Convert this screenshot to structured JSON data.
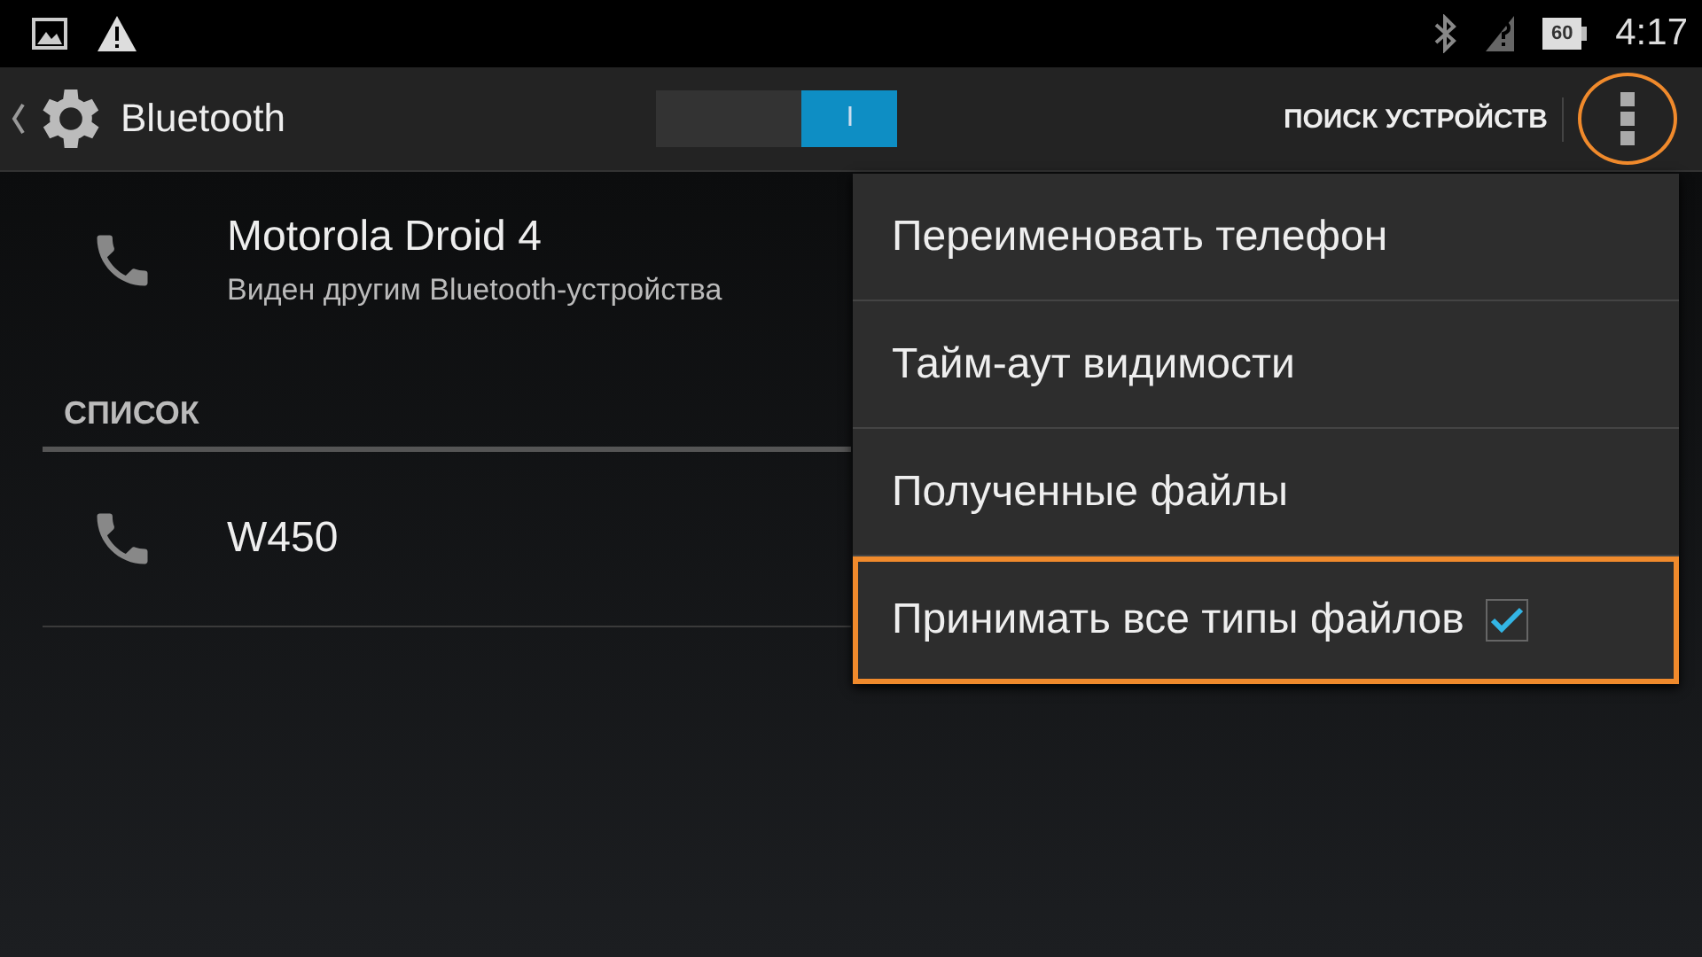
{
  "status_bar": {
    "time": "4:17",
    "battery": "60"
  },
  "action_bar": {
    "title": "Bluetooth",
    "toggle": {
      "on": true,
      "thumb_label": "I"
    },
    "action": "ПОИСК УСТРОЙСТВ",
    "overflow_highlighted": true
  },
  "this_device": {
    "name": "Motorola Droid 4",
    "subtitle": "Виден другим Bluetooth-устройства"
  },
  "section": "СПИСОК",
  "devices": [
    {
      "name": "W450"
    }
  ],
  "menu": [
    {
      "label": "Переименовать телефон",
      "kind": "plain",
      "highlighted": false
    },
    {
      "label": "Тайм-аут видимости",
      "kind": "plain",
      "highlighted": false
    },
    {
      "label": "Полученные файлы",
      "kind": "plain",
      "highlighted": false
    },
    {
      "label": "Принимать все типы файлов",
      "kind": "check",
      "checked": true,
      "highlighted": true
    }
  ]
}
